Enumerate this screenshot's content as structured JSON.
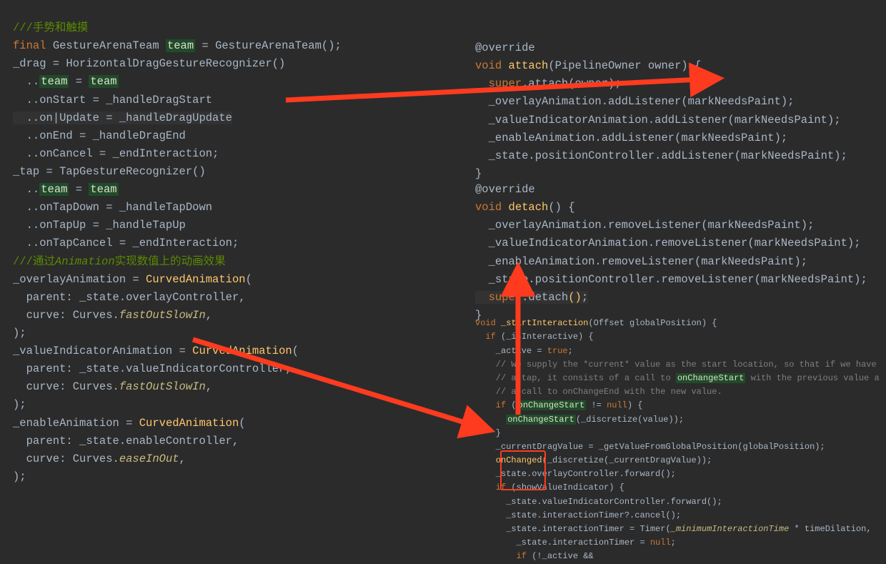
{
  "left": {
    "l01a": "///",
    "l01b": "手势和触摸",
    "l02a": "final",
    "l02b": " GestureArenaTeam ",
    "l02c": "team",
    "l02d": " = GestureArenaTeam();",
    "l03a": "_drag = HorizontalDragGestureRecognizer()",
    "l04a": "  ..",
    "l04b": "team",
    "l04c": " = ",
    "l04d": "team",
    "l05a": "  ..onStart = _handleDragStart",
    "l06a": "  ..on",
    "l06b": "Update = _handleDragUpdate",
    "l07a": "  ..onEnd = _handleDragEnd",
    "l08a": "  ..onCancel = _endInteraction;",
    "l09a": "_tap = TapGestureRecognizer()",
    "l10a": "  ..",
    "l10b": "team",
    "l10c": " = ",
    "l10d": "team",
    "l11a": "  ..onTapDown = _handleTapDown",
    "l12a": "  ..onTapUp = _handleTapUp",
    "l13a": "  ..onTapCancel = _endInteraction;",
    "l14a": "///通过",
    "l14b": "Animation",
    "l14c": "实现数值上的动画效果",
    "l15a": "_overlayAnimation = ",
    "l15b": "CurvedAnimation",
    "l15c": "(",
    "l16a": "  parent: _state.overlayController,",
    "l17a": "  curve: Curves.",
    "l17b": "fastOutSlowIn",
    "l17c": ",",
    "l18a": ");",
    "l19a": "_valueIndicatorAnimation = ",
    "l19b": "CurvedAnimation",
    "l19c": "(",
    "l20a": "  parent: _state.valueIndicatorController,",
    "l21a": "  curve: Curves.",
    "l21b": "fastOutSlowIn",
    "l21c": ",",
    "l22a": ");",
    "l23a": "_enableAnimation = ",
    "l23b": "CurvedAnimation",
    "l23c": "(",
    "l24a": "  parent: _state.enableController,",
    "l25a": "  curve: Curves.",
    "l25b": "easeInOut",
    "l25c": ",",
    "l26a": ");"
  },
  "rtop": {
    "l1": "@override",
    "l2a": "void",
    "l2b": " attach",
    "l2c": "(PipelineOwner owner) {",
    "l3a": "  super",
    "l3b": ".attach(owner);",
    "l4": "  _overlayAnimation.addListener(markNeedsPaint);",
    "l5": "  _valueIndicatorAnimation.addListener(markNeedsPaint);",
    "l6": "  _enableAnimation.addListener(markNeedsPaint);",
    "l7": "  _state.positionController.addListener(markNeedsPaint);",
    "l8": "}"
  },
  "rmid": {
    "l1": "@override",
    "l2a": "void",
    "l2b": " detach",
    "l2c": "() {",
    "l3": "  _overlayAnimation.removeListener(markNeedsPaint);",
    "l4": "  _valueIndicatorAnimation.removeListener(markNeedsPaint);",
    "l5": "  _enableAnimation.removeListener(markNeedsPaint);",
    "l6": "  _state.positionController.removeListener(markNeedsPaint);",
    "l7a": "  super",
    "l7b": ".detach",
    "l7c": "()",
    "l7d": ";",
    "l8": "}"
  },
  "rbot": {
    "l1a": "void",
    "l1b": " _startInteraction",
    "l1c": "(Offset globalPosition) {",
    "l2a": "  if",
    "l2b": " (_isInteractive) {",
    "l3a": "    _active = ",
    "l3b": "true",
    "l3c": ";",
    "l4": "    // We supply the *current* value as the start location, so that if we have",
    "l5a": "    // a tap, it consists of a call to ",
    "l5b": "onChangeStart",
    "l5c": " with the previous value a",
    "l6": "    // a call to onChangeEnd with the new value.",
    "l7a": "    if",
    "l7b": " (",
    "l7c": "onChangeStart",
    "l7d": " != ",
    "l7e": "null",
    "l7f": ") {",
    "l8a": "      ",
    "l8b": "onChangeStart",
    "l8c": "(_discretize(value));",
    "l9": "    }",
    "l10": "    _currentDragValue = _getValueFromGlobalPosition(globalPosition);",
    "l11a": "    onChanged",
    "l11b": "(_discretize(_currentDragValue));",
    "l12": "    _state.overlayController.forward();",
    "l13a": "    if",
    "l13b": " (showValueIndicator) {",
    "l14": "      _state.valueIndicatorController.forward();",
    "l15": "      _state.interactionTimer?.cancel();",
    "l16a": "      _state.interactionTimer = Timer(",
    "l16b": "_minimumInteractionTime",
    "l16c": " * timeDilation,",
    "l17a": "        _state.interactionTimer = ",
    "l17b": "null",
    "l17c": ";",
    "l18a": "        if",
    "l18b": " (!_active &&"
  }
}
